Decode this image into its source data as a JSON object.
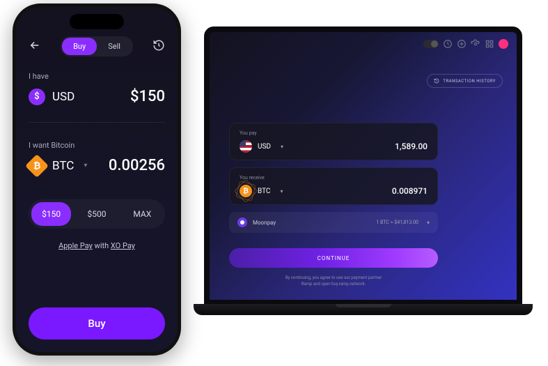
{
  "phone": {
    "tabs": {
      "buy": "Buy",
      "sell": "Sell"
    },
    "have_label": "I have",
    "have_currency": "USD",
    "have_symbol": "$",
    "have_amount": "$150",
    "want_label": "I want Bitcoin",
    "want_currency": "BTC",
    "want_amount": "0.00256",
    "presets": {
      "p1": "$150",
      "p2": "$500",
      "p3": "MAX"
    },
    "pay_note_pre": "Apple Pay",
    "pay_note_mid": " with ",
    "pay_note_post": "XO Pay",
    "buy_button": "Buy"
  },
  "desktop": {
    "tx_history": "TRANSACTION HISTORY",
    "pay_label": "You pay",
    "pay_currency": "USD",
    "pay_amount": "1,589.00",
    "receive_label": "You receive",
    "receive_currency": "BTC",
    "receive_amount": "0.008971",
    "provider_name": "Moonpay",
    "provider_rate": "1 BTC ≈ $41,813.00",
    "continue": "CONTINUE",
    "disclaimer_1": "By continuing, you agree to use our payment partner",
    "disclaimer_2": "Ramp and open buy.ramp.network."
  }
}
